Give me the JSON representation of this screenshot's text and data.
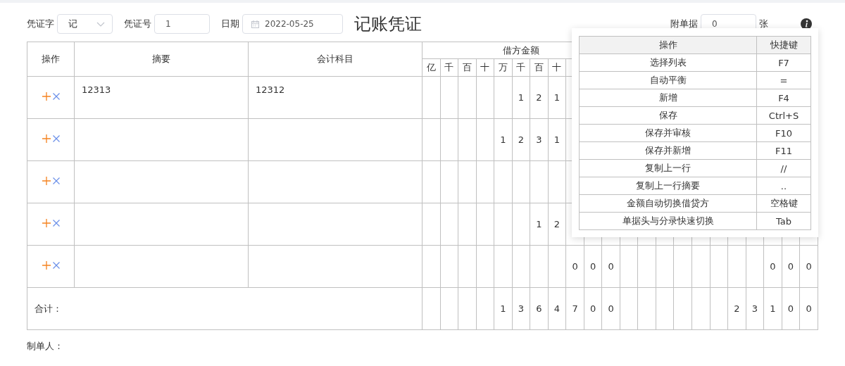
{
  "header": {
    "voucher_type": {
      "label": "凭证字",
      "value": "记"
    },
    "voucher_no": {
      "label": "凭证号",
      "value": "1"
    },
    "date": {
      "label": "日期",
      "value": "2022-05-25"
    },
    "title": "记账凭证",
    "attachments": {
      "label": "附单据",
      "value": "0",
      "unit": "张"
    }
  },
  "table": {
    "columns": {
      "ops": "操作",
      "summary": "摘要",
      "account": "会计科目",
      "debit": "借方金额"
    },
    "debit_places": [
      "亿",
      "千",
      "百",
      "十",
      "万",
      "千",
      "百",
      "十"
    ],
    "rows": [
      {
        "summary": "12313",
        "account": "12312",
        "debit": {
          "digits": "1 2 1",
          "kind": "tens"
        }
      },
      {
        "debit": {
          "digits": "1 2 3 1",
          "kind": "tens"
        }
      },
      {},
      {
        "debit": {
          "digits": "1 2",
          "kind": "tens"
        }
      },
      {
        "debit": {
          "digits": "0 0 0",
          "kind": "cents"
        },
        "credit": {
          "digits": "0 0 0",
          "kind": "cents"
        }
      }
    ],
    "total": {
      "label": "合计：",
      "debit": {
        "digits": "1 3 6 4 7 0 0",
        "kind": "cents"
      },
      "credit": {
        "digits": "2 3 1 0 0",
        "kind": "cents"
      }
    }
  },
  "shortcuts": {
    "columns": [
      "操作",
      "快捷键"
    ],
    "rows": [
      {
        "action": "选择列表",
        "key": "F7"
      },
      {
        "action": "自动平衡",
        "key": "="
      },
      {
        "action": "新增",
        "key": "F4"
      },
      {
        "action": "保存",
        "key": "Ctrl+S"
      },
      {
        "action": "保存并审核",
        "key": "F10"
      },
      {
        "action": "保存并新增",
        "key": "F11"
      },
      {
        "action": "复制上一行",
        "key": "//"
      },
      {
        "action": "复制上一行摘要",
        "key": ".."
      },
      {
        "action": "金额自动切换借贷方",
        "key": "空格键"
      },
      {
        "action": "单据头与分录快速切换",
        "key": "Tab"
      }
    ]
  },
  "footer": {
    "maker_label": "制单人："
  }
}
